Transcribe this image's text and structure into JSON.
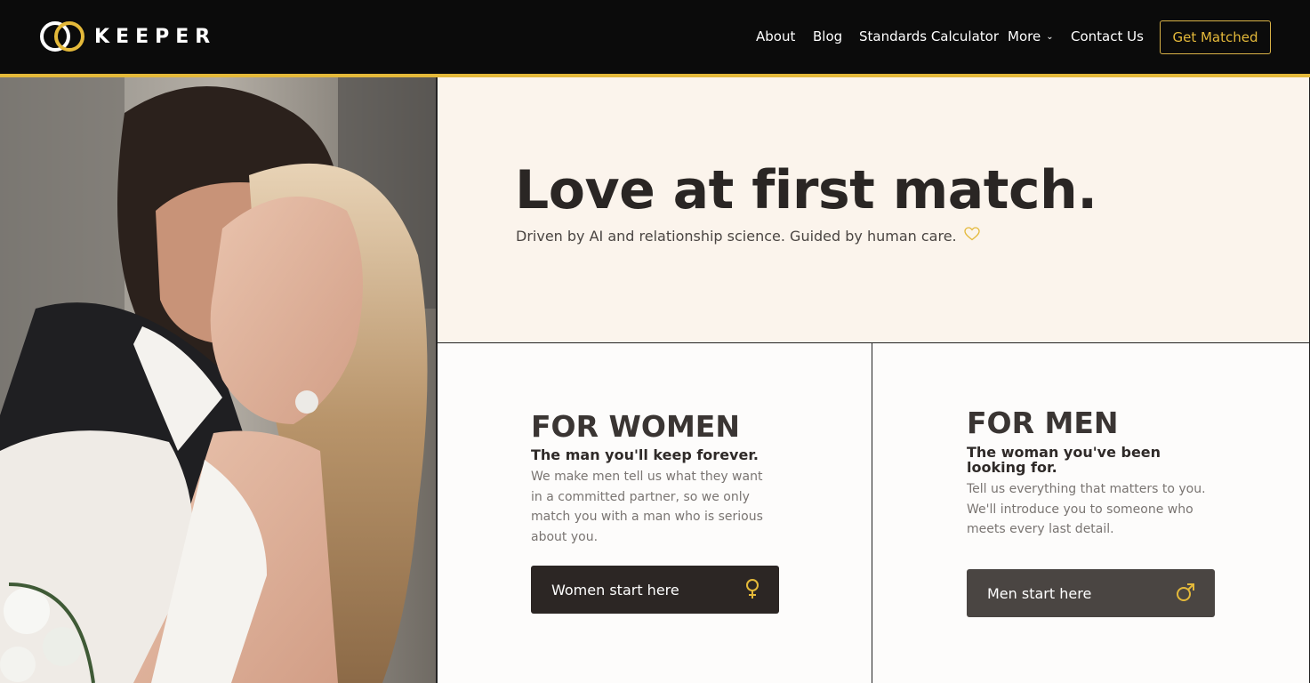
{
  "header": {
    "brand": "KEEPER",
    "nav": [
      {
        "label": "About"
      },
      {
        "label": "Blog"
      },
      {
        "label": "Standards Calculator"
      },
      {
        "label": "More"
      },
      {
        "label": "Contact Us"
      }
    ],
    "cta_label": "Get Matched"
  },
  "hero": {
    "headline": "Love at first match.",
    "subline": "Driven by AI and relationship science. Guided by human care."
  },
  "women": {
    "title": "FOR WOMEN",
    "subtitle": "The man you'll keep forever.",
    "body": "We make men tell us what they want in a committed partner, so we only match you with a man who is serious about you.",
    "button": "Women start here"
  },
  "men": {
    "title": "FOR MEN",
    "subtitle": "The woman you've been looking for.",
    "body": "Tell us everything that matters to you. We'll introduce you to someone who meets every last detail.",
    "button": "Men start here"
  },
  "colors": {
    "accent": "#e4b93a",
    "header_bg": "#0b0b0b",
    "hero_bg": "#fbf4ec",
    "women_button": "#2c2624",
    "men_button": "#4a4542"
  },
  "icons": [
    "keeper-rings-logo-icon",
    "chevron-down-icon",
    "heart-outline-icon",
    "female-symbol-icon",
    "male-symbol-icon"
  ]
}
